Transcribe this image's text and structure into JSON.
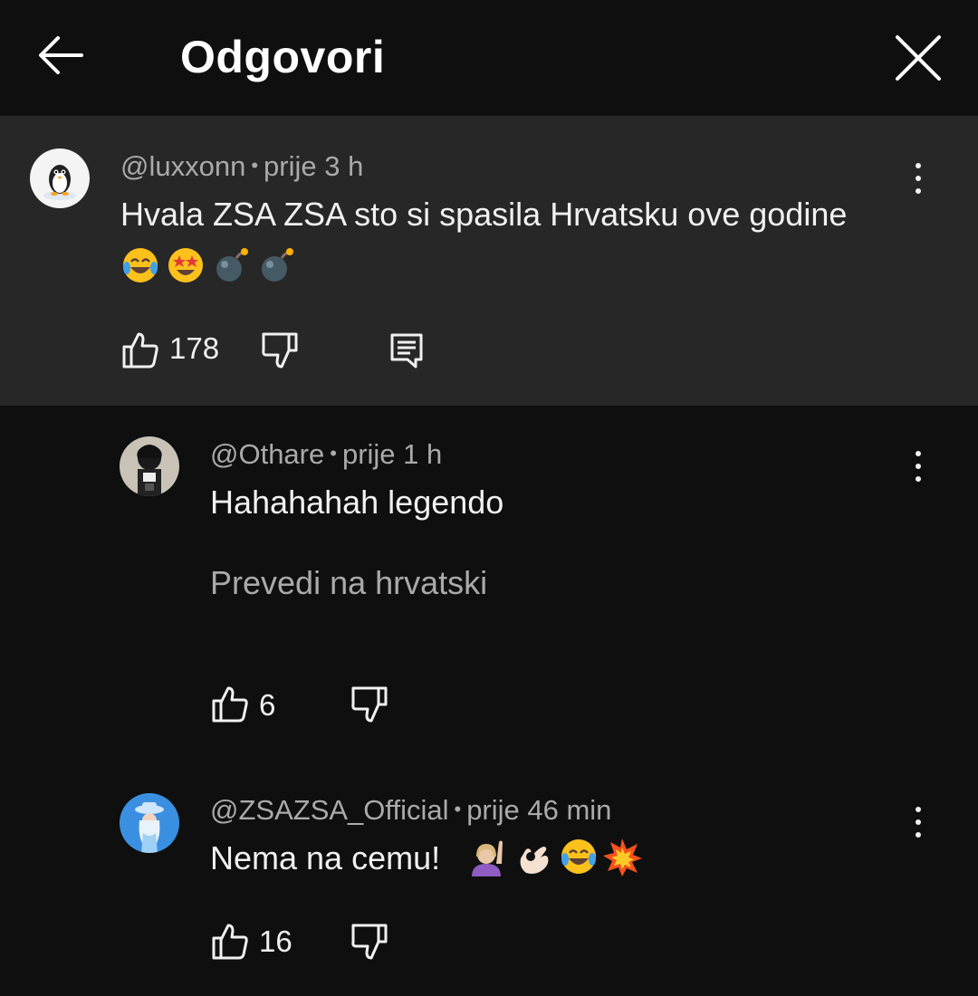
{
  "header": {
    "title": "Odgovori",
    "back_icon": "arrow-left-icon",
    "close_icon": "close-icon"
  },
  "comments": [
    {
      "author": "@luxxonn",
      "time": "prije 3 h",
      "text": "Hvala ZSA ZSA sto si spasila Hrvatsku ove godine",
      "emojis": [
        "tears-of-joy",
        "star-struck",
        "bomb",
        "bomb"
      ],
      "likes": "178",
      "avatar_icon": "penguin-avatar-icon"
    },
    {
      "author": "@Othare",
      "time": "prije 1 h",
      "text": "Hahahahah legendo",
      "translate": "Prevedi na hrvatski",
      "likes": "6",
      "avatar_icon": "dark-figure-avatar-icon"
    },
    {
      "author": "@ZSAZSA_Official",
      "time": "prije 46 min",
      "text": "Nema na cemu!",
      "emojis": [
        "woman-raising-hand",
        "ok-hand",
        "tears-of-joy",
        "collision"
      ],
      "likes": "16",
      "avatar_icon": "blue-portrait-avatar-icon"
    }
  ],
  "colors": {
    "background": "#0f0f0f",
    "highlight": "#272727",
    "text": "#f1f1f1",
    "secondary": "#aaaaaa"
  }
}
